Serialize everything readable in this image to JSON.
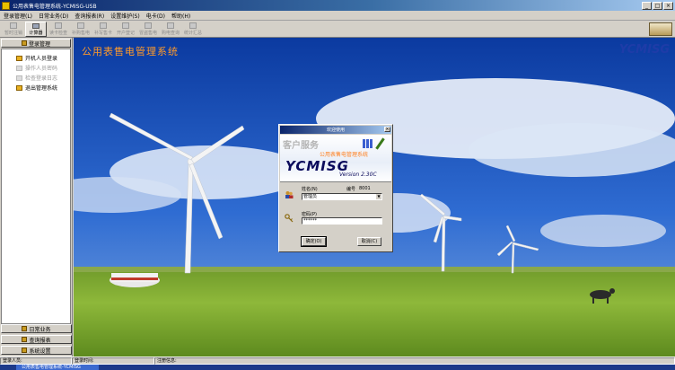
{
  "window": {
    "title": "公用表售电管理系统-YCMISG-USB",
    "min": "_",
    "max": "□",
    "close": "×"
  },
  "menu": [
    "登录管理(L)",
    "日常业务(D)",
    "查询报表(R)",
    "设置维护(S)",
    "电卡(D)",
    "帮助(H)"
  ],
  "toolbar": [
    {
      "label": "暂时注销",
      "dim": true
    },
    {
      "label": "计算器",
      "dim": false,
      "active": true
    },
    {
      "label": "读卡检查",
      "dim": true
    },
    {
      "label": "补购售电",
      "dim": true
    },
    {
      "label": "补写售卡",
      "dim": true
    },
    {
      "label": "开户登记",
      "dim": true
    },
    {
      "label": "冒盗售电",
      "dim": true
    },
    {
      "label": "购电查询",
      "dim": true
    },
    {
      "label": "统计汇总",
      "dim": true
    }
  ],
  "sidebar": {
    "header": "登录管理",
    "items": [
      {
        "label": "开机人员登录",
        "dim": false
      },
      {
        "label": "操作人员密码",
        "dim": true
      },
      {
        "label": "检查登录日志",
        "dim": true
      },
      {
        "label": "退出管理系统",
        "dim": false
      }
    ],
    "bottom": [
      "日常业务",
      "查询报表",
      "系统设置"
    ]
  },
  "main": {
    "app_name": "公用表售电管理系统",
    "brand": "YCMISG"
  },
  "status": [
    {
      "label": "登录人员:"
    },
    {
      "label": "登录时间:"
    },
    {
      "label": "注册信息:"
    }
  ],
  "taskbar": {
    "item": "公用表售电管理系统-YCMISG"
  },
  "dialog": {
    "title": "欢迎使用",
    "close": "×",
    "watermark": "客户服务",
    "subtitle": "公用表售电管理系统",
    "logo": "YCMISG",
    "version": "Version  2.30C",
    "name_label": "姓名(N)",
    "number_label": "编号",
    "number_value": "8001",
    "user_value": "管理员",
    "dropdown_arrow": "▼",
    "password_label": "密码(P)",
    "password_value": "******",
    "ok_label": "确定(O)",
    "cancel_label": "取消(C)"
  },
  "colors": {
    "titlebar": "#0a246a",
    "accent_orange": "#ff9a2a",
    "brand_blue": "#1e3ca8"
  }
}
